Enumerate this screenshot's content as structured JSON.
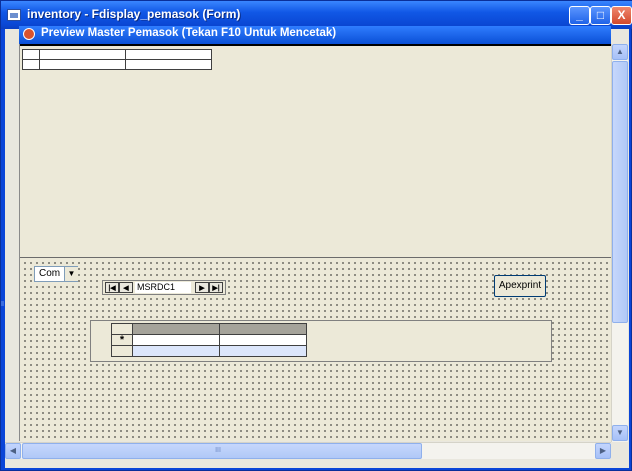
{
  "window": {
    "title": "inventory - Fdisplay_pemasok (Form)",
    "minimize_glyph": "_",
    "maximize_glyph": "□",
    "close_glyph": "X",
    "accent_color": "#0a45d8"
  },
  "child_form": {
    "title": "Preview Master Pemasok (Tekan F10 Untuk Mencetak)"
  },
  "design": {
    "combo": {
      "value": "Com",
      "arrow": "▼"
    },
    "navigator": {
      "first": "|◀",
      "prev": "◀",
      "caption": "MSRDC1",
      "next": "▶",
      "last": "▶|"
    },
    "print_button": "Apexprint",
    "subgrid": {
      "new_row_marker": "*"
    }
  },
  "scrollbars": {
    "up": "▲",
    "down": "▼",
    "left": "◀",
    "right": "▶",
    "grip": "III"
  }
}
